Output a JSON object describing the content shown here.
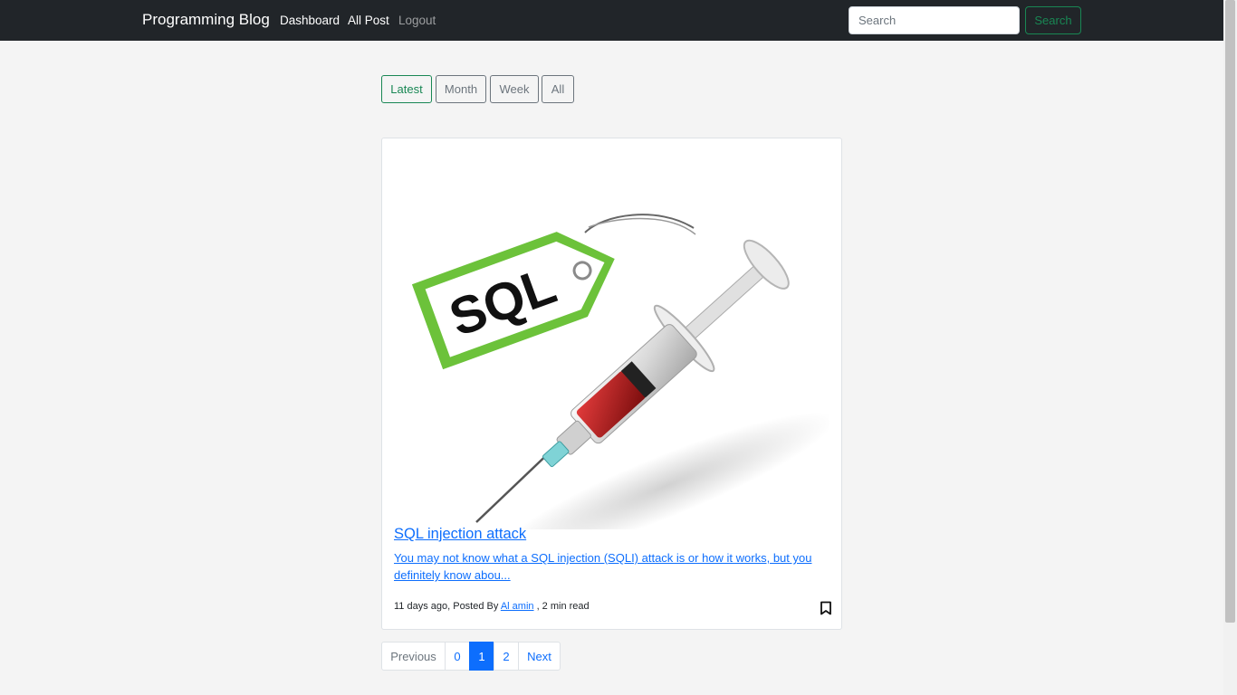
{
  "navbar": {
    "brand": "Programming Blog",
    "links": [
      "Dashboard",
      "All Post",
      "Logout"
    ],
    "search": {
      "placeholder": "Search",
      "button_label": "Search"
    }
  },
  "filters": [
    "Latest",
    "Month",
    "Week",
    "All"
  ],
  "active_filter": "Latest",
  "post": {
    "image_tag_text": "SQL",
    "title": "SQL injection attack",
    "excerpt": "You may not know what a SQL injection (SQLI) attack is or how it works, but you definitely know abou...",
    "meta_prefix": "11 days ago, Posted By ",
    "author": "Al amin",
    "meta_suffix": " , 2 min read",
    "icons": {
      "bookmark": "bookmark-icon"
    }
  },
  "pagination": {
    "previous": "Previous",
    "pages": [
      "0",
      "1",
      "2"
    ],
    "active_page": "1",
    "next": "Next"
  },
  "colors": {
    "navbar_bg": "#212529",
    "success": "#198754",
    "primary": "#0d6efd",
    "secondary": "#6c757d"
  }
}
